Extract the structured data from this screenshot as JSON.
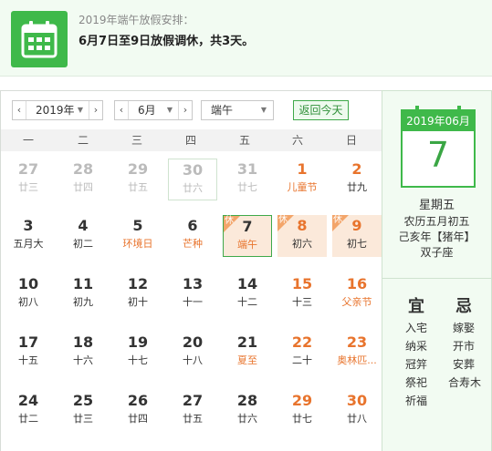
{
  "banner": {
    "title": "2019年端午放假安排：",
    "text": "6月7日至9日放假调休，共3天。"
  },
  "toolbar": {
    "year": "2019年",
    "month": "6月",
    "holiday": "端午",
    "today_button": "返回今天",
    "prev": "‹",
    "next": "›",
    "dropdown": "▼"
  },
  "weekdays": [
    "一",
    "二",
    "三",
    "四",
    "五",
    "六",
    "日"
  ],
  "holiday_tag": "休",
  "days": [
    [
      {
        "n": "27",
        "l": "廿三",
        "t": "other"
      },
      {
        "n": "28",
        "l": "廿四",
        "t": "other"
      },
      {
        "n": "29",
        "l": "廿五",
        "t": "other"
      },
      {
        "n": "30",
        "l": "廿六",
        "t": "other outline"
      },
      {
        "n": "31",
        "l": "廿七",
        "t": "other"
      },
      {
        "n": "1",
        "l": "儿童节",
        "t": "wknd fest"
      },
      {
        "n": "2",
        "l": "廿九",
        "t": "wknd"
      }
    ],
    [
      {
        "n": "3",
        "l": "五月大",
        "t": ""
      },
      {
        "n": "4",
        "l": "初二",
        "t": ""
      },
      {
        "n": "5",
        "l": "环境日",
        "t": "fest"
      },
      {
        "n": "6",
        "l": "芒种",
        "t": "fest"
      },
      {
        "n": "7",
        "l": "端午",
        "t": "sel7 fest",
        "h": true
      },
      {
        "n": "8",
        "l": "初六",
        "t": "hol",
        "h": true
      },
      {
        "n": "9",
        "l": "初七",
        "t": "hol",
        "h": true
      }
    ],
    [
      {
        "n": "10",
        "l": "初八",
        "t": ""
      },
      {
        "n": "11",
        "l": "初九",
        "t": ""
      },
      {
        "n": "12",
        "l": "初十",
        "t": ""
      },
      {
        "n": "13",
        "l": "十一",
        "t": ""
      },
      {
        "n": "14",
        "l": "十二",
        "t": ""
      },
      {
        "n": "15",
        "l": "十三",
        "t": "wknd"
      },
      {
        "n": "16",
        "l": "父亲节",
        "t": "wknd fest"
      }
    ],
    [
      {
        "n": "17",
        "l": "十五",
        "t": ""
      },
      {
        "n": "18",
        "l": "十六",
        "t": ""
      },
      {
        "n": "19",
        "l": "十七",
        "t": ""
      },
      {
        "n": "20",
        "l": "十八",
        "t": ""
      },
      {
        "n": "21",
        "l": "夏至",
        "t": "fest"
      },
      {
        "n": "22",
        "l": "二十",
        "t": "wknd"
      },
      {
        "n": "23",
        "l": "奥林匹...",
        "t": "wknd fest"
      }
    ],
    [
      {
        "n": "24",
        "l": "廿二",
        "t": ""
      },
      {
        "n": "25",
        "l": "廿三",
        "t": ""
      },
      {
        "n": "26",
        "l": "廿四",
        "t": ""
      },
      {
        "n": "27",
        "l": "廿五",
        "t": ""
      },
      {
        "n": "28",
        "l": "廿六",
        "t": ""
      },
      {
        "n": "29",
        "l": "廿七",
        "t": "wknd"
      },
      {
        "n": "30",
        "l": "廿八",
        "t": "wknd"
      }
    ]
  ],
  "side": {
    "header": "2019年06月",
    "day": "7",
    "weekday": "星期五",
    "lunar": "农历五月初五",
    "ganzhi": "己亥年【猪年】",
    "zodiac": "双子座",
    "yi_title": "宜",
    "ji_title": "忌",
    "yi": [
      "入宅",
      "纳采",
      "冠笄",
      "祭祀",
      "祈福"
    ],
    "ji": [
      "嫁娶",
      "开市",
      "安葬",
      "合寿木"
    ]
  }
}
